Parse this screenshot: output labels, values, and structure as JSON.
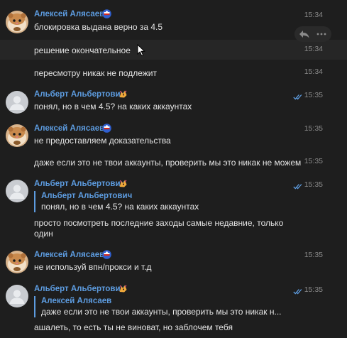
{
  "messages": [
    {
      "sender": "Алексей Алясаев",
      "text": "блокировка выдана верно за 4.5",
      "time": "15:34"
    },
    {
      "text": "решение окончательное",
      "time": "15:34"
    },
    {
      "text": "пересмотру никак не подлежит",
      "time": "15:34"
    },
    {
      "sender": "Альберт Альбертович",
      "text": "понял, но в чем 4.5? на каких аккаунтах",
      "time": "15:35"
    },
    {
      "sender": "Алексей Алясаев",
      "text": "не предоставляем доказательства",
      "time": "15:35"
    },
    {
      "text": "даже если это не твои аккаунты, проверить мы это никак не можем",
      "time": "15:35"
    },
    {
      "sender": "Альберт Альбертович",
      "quote_name": "Альберт Альбертович",
      "quote_text": "понял, но в чем 4.5? на каких аккаунтах",
      "text_line1": "просто посмотреть последние заходы самые недавние, только",
      "text_line2": "один",
      "time": "15:35"
    },
    {
      "sender": "Алексей Алясаев",
      "text": "не используй впн/прокси и т.д",
      "time": "15:35"
    },
    {
      "sender": "Альберт Альбертович",
      "quote_name": "Алексей Алясаев",
      "quote_text": "даже если это не твои аккаунты, проверить мы это никак н...",
      "text": "ашалеть, то есть ты не виноват, но заблочем тебя",
      "time": "15:35"
    }
  ],
  "icons": {
    "reply": "reply-icon",
    "more": "more-icon",
    "read": "double-check-icon",
    "badge_aleksey": "flag-badge-icon",
    "badge_albert": "dragon-badge-icon"
  },
  "colors": {
    "background": "#1e1e1e",
    "name": "#5d9ce0",
    "text": "#e4e4e4",
    "time": "#8a8a8a"
  }
}
